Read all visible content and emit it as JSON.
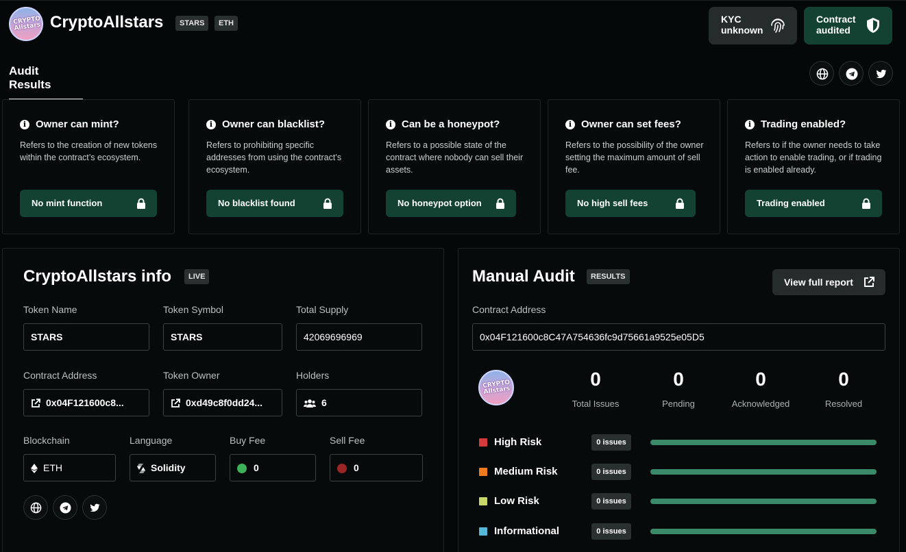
{
  "header": {
    "logo_text": "CRYPTO Allstars",
    "title": "CryptoAllstars",
    "tags": [
      "STARS",
      "ETH"
    ],
    "kyc": {
      "line1": "KYC",
      "line2": "unknown"
    },
    "contract": {
      "line1": "Contract",
      "line2": "audited"
    }
  },
  "tabs": {
    "active": "Audit Results"
  },
  "social_icons": [
    "globe-icon",
    "telegram-icon",
    "twitter-icon"
  ],
  "cards": [
    {
      "title": "Owner can mint?",
      "desc": "Refers to the creation of new tokens within the contract’s ecosystem.",
      "badge": "No mint function"
    },
    {
      "title": "Owner can blacklist?",
      "desc": "Refers to prohibiting specific addresses from using the contract’s ecosystem.",
      "badge": "No blacklist found"
    },
    {
      "title": "Can be a honeypot?",
      "desc": "Refers to a possible state of the contract where nobody can sell their assets.",
      "badge": "No honeypot option"
    },
    {
      "title": "Owner can set fees?",
      "desc": "Refers to the possibility of the owner setting the maximum amount of sell fee.",
      "badge": "No high sell fees"
    },
    {
      "title": "Trading enabled?",
      "desc": "Refers to if the owner needs to take action to enable trading, or if trading is enabled already.",
      "badge": "Trading enabled"
    }
  ],
  "info": {
    "title": "CryptoAllstars info",
    "tag": "LIVE",
    "token_name_label": "Token Name",
    "token_name": "STARS",
    "token_symbol_label": "Token Symbol",
    "token_symbol": "STARS",
    "total_supply_label": "Total Supply",
    "total_supply": "42069696969",
    "contract_address_label": "Contract Address",
    "contract_address": "0x04F121600c8...",
    "token_owner_label": "Token Owner",
    "token_owner": "0xd49c8f0dd24...",
    "holders_label": "Holders",
    "holders": "6",
    "blockchain_label": "Blockchain",
    "blockchain": "ETH",
    "language_label": "Language",
    "language": "Solidity",
    "buy_fee_label": "Buy Fee",
    "buy_fee": "0",
    "sell_fee_label": "Sell Fee",
    "sell_fee": "0"
  },
  "audit": {
    "title": "Manual Audit",
    "tag": "RESULTS",
    "view_button": "View full report",
    "contract_label": "Contract Address",
    "contract_address": "0x04F121600c8C47A754636fc9d75661a9525e05D5",
    "stats": [
      {
        "value": "0",
        "label": "Total Issues"
      },
      {
        "value": "0",
        "label": "Pending"
      },
      {
        "value": "0",
        "label": "Acknowledged"
      },
      {
        "value": "0",
        "label": "Resolved"
      }
    ],
    "risks": [
      {
        "name": "High Risk",
        "badge": "0 issues",
        "color": "#d63a3a",
        "progress": 1.0
      },
      {
        "name": "Medium Risk",
        "badge": "0 issues",
        "color": "#f07a1e",
        "progress": 1.0
      },
      {
        "name": "Low Risk",
        "badge": "0 issues",
        "color": "#c9d66a",
        "progress": 1.0
      },
      {
        "name": "Informational",
        "badge": "0 issues",
        "color": "#55b8d8",
        "progress": 1.0
      }
    ]
  },
  "colors": {
    "accent_green": "#134232",
    "bar_green": "#3a8a6a",
    "buy_fee_dot": "#3cb35a",
    "sell_fee_dot": "#9a2525"
  }
}
